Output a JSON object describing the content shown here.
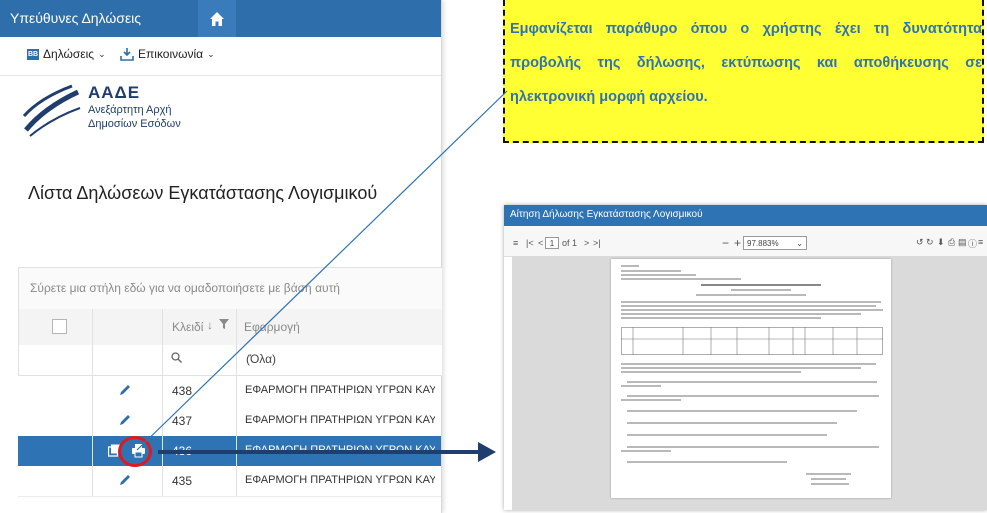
{
  "app": {
    "title": "Υπεύθυνες Δηλώσεις",
    "menu": [
      {
        "label": "Δηλώσεις",
        "icon": "document-badge-icon"
      },
      {
        "label": "Επικοινωνία",
        "icon": "download-tray-icon"
      }
    ],
    "org": {
      "short": "ΑΑΔΕ",
      "line1": "Ανεξάρτητη Αρχή",
      "line2": "Δημοσίων Εσόδων"
    },
    "page_title": "Λίστα Δηλώσεων Εγκατάστασης Λογισμικού",
    "grid": {
      "group_panel": "Σύρετε μια στήλη εδώ για να ομαδοποιήσετε με βάση αυτή",
      "columns": {
        "key": "Κλειδί",
        "app": "Εφαρμογή"
      },
      "filter_all": "(Όλα)",
      "rows": [
        {
          "key": "438",
          "app": "ΕΦΑΡΜΟΓΗ ΠΡΑΤΗΡΙΩΝ ΥΓΡΩΝ ΚΑΥΣΙΜΩΝ",
          "selected": false
        },
        {
          "key": "437",
          "app": "ΕΦΑΡΜΟΓΗ ΠΡΑΤΗΡΙΩΝ ΥΓΡΩΝ ΚΑΥΣΙΜΩΝ",
          "selected": false
        },
        {
          "key": "436",
          "app": "ΕΦΑΡΜΟΓΗ ΠΡΑΤΗΡΙΩΝ ΥΓΡΩΝ ΚΑΥΣΙΜΩΝ",
          "selected": true
        },
        {
          "key": "435",
          "app": "ΕΦΑΡΜΟΓΗ ΠΡΑΤΗΡΙΩΝ ΥΓΡΩΝ ΚΑΥΣΙΜΩΝ",
          "selected": false
        }
      ]
    }
  },
  "callout": {
    "text": "Εμφανίζεται παράθυρο όπου ο χρήστης έχει τη δυνατότητα προβολής της δήλωσης, εκτύπωσης και αποθήκευσης σε ηλεκτρονική μορφή αρχείου.",
    "color": "#2e74b5",
    "background": "#ffff33"
  },
  "dialog": {
    "title": "Αίτηση Δήλωσης Εγκατάστασης Λογισμικού",
    "page_current": "1",
    "page_total": "of 1",
    "zoom": "97.883%",
    "accent": "#2e74b5"
  },
  "colors": {
    "header": "#2e6eaa",
    "selected_row": "#2e74b5",
    "highlight_circle": "#e0191e"
  }
}
